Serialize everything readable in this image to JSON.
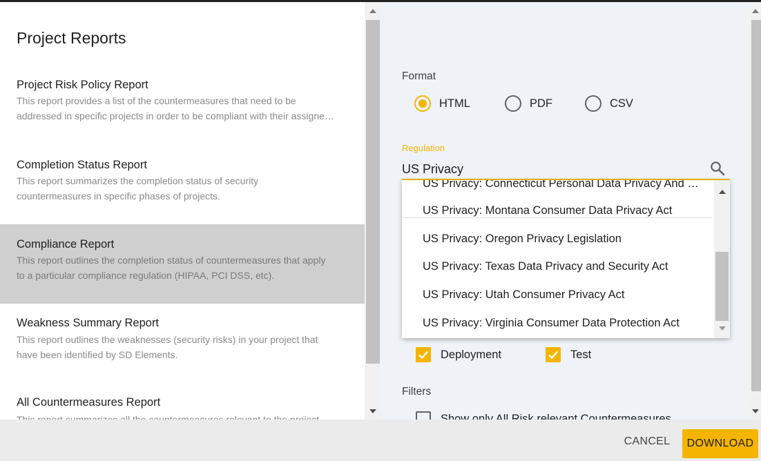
{
  "page_title": "Project Reports",
  "reports": [
    {
      "title": "Project Risk Policy Report",
      "desc_line1": "This report provides a list of the countermeasures that need to be",
      "desc_line2": "addressed in specific projects in order to be compliant with their assigne…"
    },
    {
      "title": "Completion Status Report",
      "desc_line1": "This report summarizes the completion status of security",
      "desc_line2": "countermeasures in specific phases of projects."
    },
    {
      "title": "Compliance Report",
      "desc_line1": "This report outlines the completion status of countermeasures that apply",
      "desc_line2": "to a particular compliance regulation (HIPAA, PCI DSS, etc)."
    },
    {
      "title": "Weakness Summary Report",
      "desc_line1": "This report outlines the weaknesses (security risks) in your project that",
      "desc_line2": "have been identified by SD Elements."
    },
    {
      "title": "All Countermeasures Report",
      "desc_line1": "This report summarizes all the countermeasures relevant to the project",
      "desc_line2": ""
    }
  ],
  "format": {
    "label": "Format",
    "options": [
      "HTML",
      "PDF",
      "CSV"
    ],
    "selected": "HTML"
  },
  "regulation": {
    "label": "Regulation",
    "value": "US Privacy",
    "options": [
      "US Privacy: Connecticut Personal Data Privacy And …",
      "US Privacy: Montana Consumer Data Privacy Act",
      "US Privacy: Oregon Privacy Legislation",
      "US Privacy: Texas Data Privacy and Security Act",
      "US Privacy: Utah Consumer Privacy Act",
      "US Privacy: Virginia Consumer Data Protection Act"
    ]
  },
  "phases": [
    "Deployment",
    "Test"
  ],
  "filters": {
    "label": "Filters",
    "option": "Show only All Risk relevant Countermeasures"
  },
  "buttons": {
    "cancel": "CANCEL",
    "download": "DOWNLOAD"
  },
  "colors": {
    "accent": "#f5b400",
    "selected_row": "#cfcfcf",
    "right_panel_bg": "#eff2f7"
  }
}
